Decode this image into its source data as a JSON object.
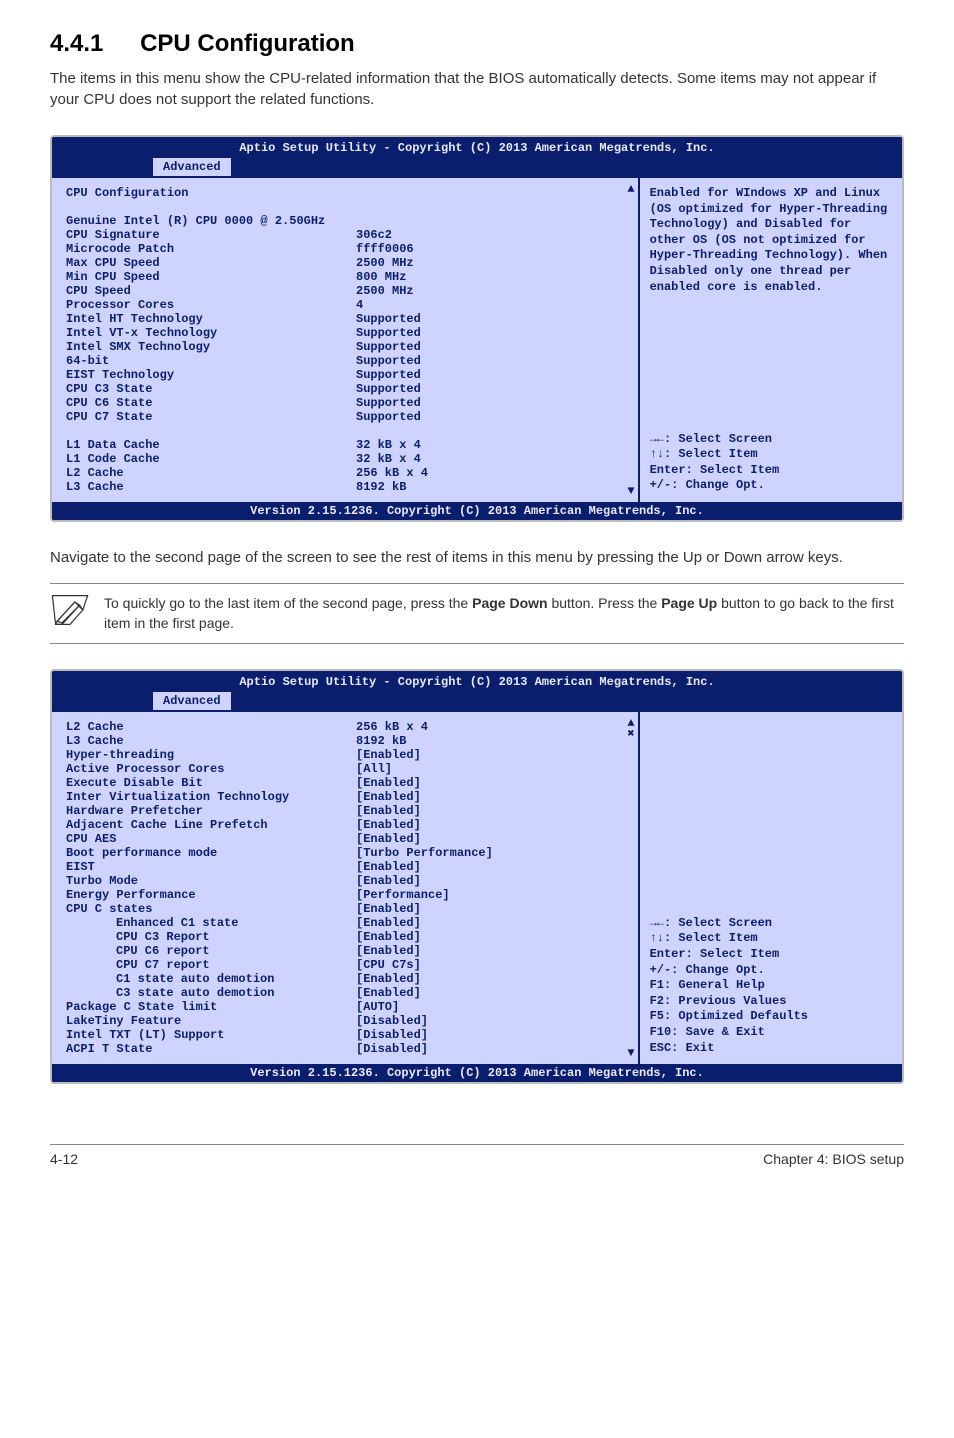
{
  "section": {
    "number": "4.4.1",
    "title": "CPU Configuration"
  },
  "intro": "The items in this menu show the CPU-related information that the BIOS automatically detects. Some items may not appear if your CPU does not support the related functions.",
  "bios1": {
    "title": "Aptio Setup Utility - Copyright (C) 2013 American Megatrends, Inc.",
    "tab": "Advanced",
    "section_header": "CPU Configuration",
    "cpu_name": "Genuine Intel (R) CPU 0000 @ 2.50GHz",
    "rows": [
      {
        "k": "CPU Signature",
        "v": "306c2"
      },
      {
        "k": "Microcode Patch",
        "v": "ffff0006"
      },
      {
        "k": "Max CPU Speed",
        "v": "2500 MHz"
      },
      {
        "k": "Min CPU Speed",
        "v": "800 MHz"
      },
      {
        "k": "CPU Speed",
        "v": "2500 MHz"
      },
      {
        "k": "Processor Cores",
        "v": "4"
      },
      {
        "k": "Intel HT Technology",
        "v": "Supported"
      },
      {
        "k": "Intel VT-x Technology",
        "v": "Supported"
      },
      {
        "k": "Intel SMX Technology",
        "v": "Supported"
      },
      {
        "k": "64-bit",
        "v": "Supported"
      },
      {
        "k": "EIST Technology",
        "v": "Supported"
      },
      {
        "k": "CPU C3 State",
        "v": "Supported"
      },
      {
        "k": "CPU C6 State",
        "v": "Supported"
      },
      {
        "k": "CPU C7 State",
        "v": "Supported"
      }
    ],
    "cache_rows": [
      {
        "k": "L1 Data Cache",
        "v": "32 kB x 4"
      },
      {
        "k": "L1 Code Cache",
        "v": "32 kB x 4"
      },
      {
        "k": "L2 Cache",
        "v": "256 kB x 4"
      },
      {
        "k": "L3 Cache",
        "v": "8192 kB"
      }
    ],
    "help": "Enabled for WIndows XP and Linux (OS optimized for Hyper-Threading Technology) and Disabled for other OS (OS not optimized for Hyper-Threading Technology). When Disabled only one thread per enabled core is enabled.",
    "nav": [
      "→←: Select Screen",
      "↑↓:  Select Item",
      "Enter: Select Item",
      "+/-: Change Opt."
    ],
    "footer": "Version 2.15.1236. Copyright (C) 2013 American Megatrends, Inc."
  },
  "mid_text": "Navigate to the second page of the screen to see the rest of items in this menu by pressing the Up or Down arrow keys.",
  "note": {
    "pre": "To quickly go to the last item of the second page, press the ",
    "btn1": "Page Down",
    "mid": " button. Press the ",
    "btn2": "Page Up",
    "post": " button to go back to the first item in the first page."
  },
  "bios2": {
    "title": "Aptio Setup Utility - Copyright (C) 2013 American Megatrends, Inc.",
    "tab": "Advanced",
    "top_rows": [
      {
        "k": "L2 Cache",
        "v": "256 kB x 4"
      },
      {
        "k": "L3 Cache",
        "v": "8192 kB"
      }
    ],
    "rows": [
      {
        "k": "Hyper-threading",
        "v": "[Enabled]"
      },
      {
        "k": "Active Processor Cores",
        "v": "[All]"
      },
      {
        "k": "Execute Disable Bit",
        "v": "[Enabled]"
      },
      {
        "k": "Inter Virtualization Technology",
        "v": "[Enabled]"
      },
      {
        "k": "Hardware Prefetcher",
        "v": "[Enabled]"
      },
      {
        "k": "Adjacent Cache Line Prefetch",
        "v": "[Enabled]"
      },
      {
        "k": "CPU AES",
        "v": "[Enabled]"
      },
      {
        "k": "Boot performance mode",
        "v": "[Turbo Performance]"
      },
      {
        "k": "EIST",
        "v": "[Enabled]"
      },
      {
        "k": "Turbo Mode",
        "v": "[Enabled]"
      },
      {
        "k": "Energy Performance",
        "v": "[Performance]"
      },
      {
        "k": "CPU C states",
        "v": "[Enabled]"
      }
    ],
    "indented_rows": [
      {
        "k": "Enhanced C1 state",
        "v": "[Enabled]"
      },
      {
        "k": "CPU C3 Report",
        "v": "[Enabled]"
      },
      {
        "k": "CPU C6 report",
        "v": "[Enabled]"
      },
      {
        "k": "CPU C7 report",
        "v": "[CPU C7s]"
      },
      {
        "k": "C1 state auto demotion",
        "v": "[Enabled]"
      },
      {
        "k": "C3 state auto demotion",
        "v": "[Enabled]"
      }
    ],
    "rows2": [
      {
        "k": "Package C State limit",
        "v": "[AUTO]"
      },
      {
        "k": "LakeTiny Feature",
        "v": "[Disabled]"
      },
      {
        "k": "Intel TXT (LT) Support",
        "v": "[Disabled]"
      },
      {
        "k": "ACPI T State",
        "v": "[Disabled]"
      }
    ],
    "nav": [
      "→←: Select Screen",
      "↑↓:  Select Item",
      "Enter: Select Item",
      "+/-: Change Opt.",
      "F1: General Help",
      "F2: Previous Values",
      "F5: Optimized Defaults",
      "F10: Save & Exit",
      "ESC: Exit"
    ],
    "footer": "Version 2.15.1236. Copyright (C) 2013 American Megatrends, Inc."
  },
  "page_footer": {
    "left": "4-12",
    "right": "Chapter 4: BIOS setup"
  }
}
